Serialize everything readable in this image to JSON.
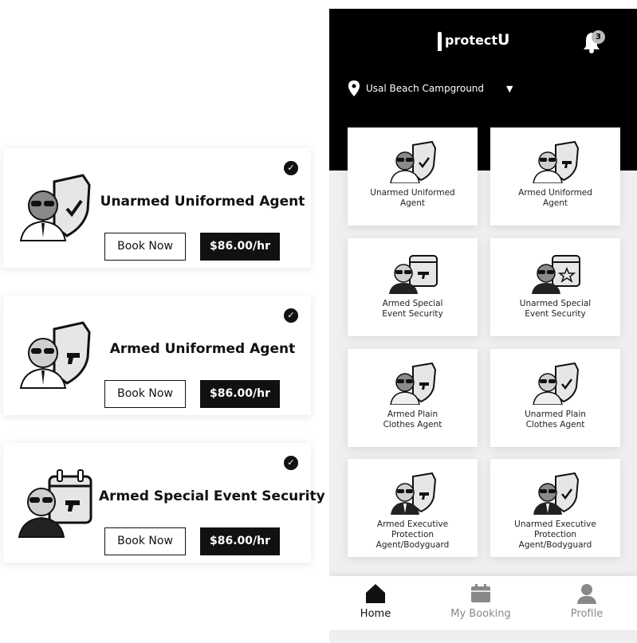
{
  "left_cards": [
    {
      "title": "Unarmed Uniformed Agent",
      "book_label": "Book Now",
      "price": "$86.00/hr",
      "icon": "check-shield-icon"
    },
    {
      "title": "Armed Uniformed Agent",
      "book_label": "Book Now",
      "price": "$86.00/hr",
      "icon": "gun-shield-icon"
    },
    {
      "title": "Armed Special Event Security",
      "book_label": "Book Now",
      "price": "$86.00/hr",
      "icon": "calendar-gun-icon"
    }
  ],
  "app": {
    "logo_text": "protect",
    "logo_letter": "U",
    "notification_count": "3",
    "location": "Usal Beach Campground",
    "tiles": [
      {
        "label": "Unarmed Uniformed\nAgent"
      },
      {
        "label": "Armed Uniformed\nAgent"
      },
      {
        "label": "Armed Special\nEvent Security"
      },
      {
        "label": "Unarmed Special\nEvent Security"
      },
      {
        "label": "Armed Plain\nClothes Agent"
      },
      {
        "label": "Unarmed Plain\nClothes Agent"
      },
      {
        "label": "Armed Executive\nProtection\nAgent/Bodyguard"
      },
      {
        "label": "Unarmed Executive\nProtection\nAgent/Bodyguard"
      }
    ],
    "nav": [
      {
        "label": "Home",
        "icon": "home-icon",
        "active": true
      },
      {
        "label": "My Booking",
        "icon": "booking-icon",
        "active": false
      },
      {
        "label": "Profile",
        "icon": "profile-icon",
        "active": false
      }
    ]
  },
  "colors": {
    "primary": "#000000",
    "background": "#efefef",
    "inactive": "#888888"
  }
}
